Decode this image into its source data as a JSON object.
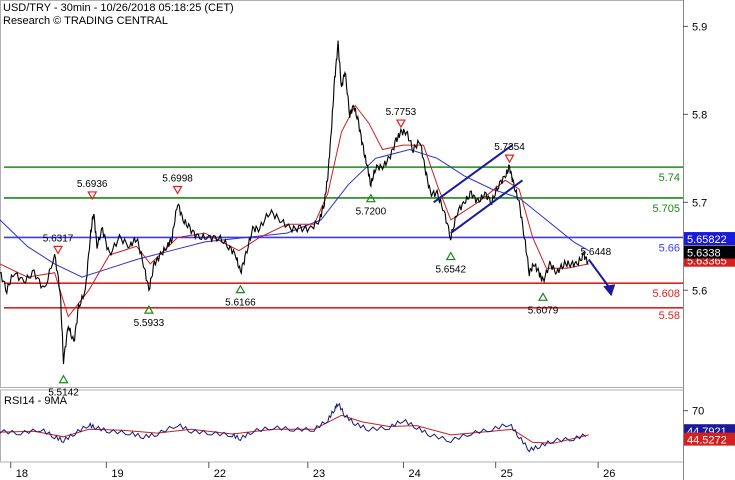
{
  "header": {
    "title": "USD/TRY - 30min - 10/26/2018 05:18:25 (CET)",
    "research": "Research © TRADING CENTRAL"
  },
  "chart_data": [
    {
      "type": "line",
      "name": "price",
      "ylim": [
        5.49,
        5.93
      ],
      "y_ticks": [
        "5.9",
        "5.8",
        "5.7",
        "5.6"
      ],
      "x_tick_labels": [
        "18",
        "19",
        "22",
        "23",
        "24",
        "25",
        "26"
      ],
      "levels": [
        {
          "value": 5.74,
          "label": "5.74",
          "color": "#1a8a1a"
        },
        {
          "value": 5.705,
          "label": "5.705",
          "color": "#1a8a1a"
        },
        {
          "value": 5.66,
          "label": "5.66",
          "color": "#3a3aff"
        },
        {
          "value": 5.608,
          "label": "5.608",
          "color": "#e02020"
        },
        {
          "value": 5.58,
          "label": "5.58",
          "color": "#e02020"
        }
      ],
      "current_price": {
        "label": "5.6338",
        "value": 5.6338
      },
      "price_tags": [
        {
          "label": "5.65822",
          "value": 5.6582,
          "color": "#1a1adb"
        },
        {
          "label": "5.63365",
          "value": 5.6336,
          "color": "#d02020"
        }
      ],
      "highs": [
        {
          "label": "5.6317",
          "x": 0.085,
          "value": 5.6317
        },
        {
          "label": "5.6936",
          "x": 0.135,
          "value": 5.6936
        },
        {
          "label": "5.6998",
          "x": 0.26,
          "value": 5.6998
        },
        {
          "label": "5.7753",
          "x": 0.587,
          "value": 5.7753
        },
        {
          "label": "5.7354",
          "x": 0.746,
          "value": 5.7354
        }
      ],
      "lows": [
        {
          "label": "5.5142",
          "x": 0.093,
          "value": 5.5142
        },
        {
          "label": "5.5933",
          "x": 0.218,
          "value": 5.5933
        },
        {
          "label": "5.6166",
          "x": 0.352,
          "value": 5.6166
        },
        {
          "label": "5.7200",
          "x": 0.543,
          "value": 5.72
        },
        {
          "label": "5.6542",
          "x": 0.66,
          "value": 5.6542
        },
        {
          "label": "5.6079",
          "x": 0.795,
          "value": 5.6079
        }
      ],
      "extra_label": {
        "label": "5.6448",
        "value": 5.6448
      },
      "price_path": [
        [
          0.0,
          5.62
        ],
        [
          0.01,
          5.6
        ],
        [
          0.02,
          5.62
        ],
        [
          0.035,
          5.61
        ],
        [
          0.05,
          5.62
        ],
        [
          0.065,
          5.6
        ],
        [
          0.08,
          5.64
        ],
        [
          0.088,
          5.6
        ],
        [
          0.093,
          5.52
        ],
        [
          0.1,
          5.56
        ],
        [
          0.108,
          5.54
        ],
        [
          0.115,
          5.58
        ],
        [
          0.125,
          5.6
        ],
        [
          0.132,
          5.66
        ],
        [
          0.137,
          5.69
        ],
        [
          0.142,
          5.65
        ],
        [
          0.15,
          5.67
        ],
        [
          0.16,
          5.64
        ],
        [
          0.175,
          5.66
        ],
        [
          0.19,
          5.65
        ],
        [
          0.2,
          5.66
        ],
        [
          0.21,
          5.63
        ],
        [
          0.218,
          5.6
        ],
        [
          0.226,
          5.63
        ],
        [
          0.235,
          5.64
        ],
        [
          0.245,
          5.65
        ],
        [
          0.252,
          5.66
        ],
        [
          0.26,
          5.7
        ],
        [
          0.268,
          5.68
        ],
        [
          0.278,
          5.67
        ],
        [
          0.29,
          5.66
        ],
        [
          0.305,
          5.66
        ],
        [
          0.32,
          5.66
        ],
        [
          0.335,
          5.65
        ],
        [
          0.345,
          5.64
        ],
        [
          0.352,
          5.62
        ],
        [
          0.36,
          5.64
        ],
        [
          0.37,
          5.67
        ],
        [
          0.38,
          5.67
        ],
        [
          0.395,
          5.69
        ],
        [
          0.41,
          5.68
        ],
        [
          0.425,
          5.67
        ],
        [
          0.44,
          5.67
        ],
        [
          0.455,
          5.67
        ],
        [
          0.468,
          5.68
        ],
        [
          0.475,
          5.7
        ],
        [
          0.48,
          5.73
        ],
        [
          0.485,
          5.78
        ],
        [
          0.49,
          5.84
        ],
        [
          0.495,
          5.88
        ],
        [
          0.5,
          5.83
        ],
        [
          0.505,
          5.85
        ],
        [
          0.512,
          5.8
        ],
        [
          0.518,
          5.81
        ],
        [
          0.525,
          5.79
        ],
        [
          0.532,
          5.76
        ],
        [
          0.538,
          5.74
        ],
        [
          0.543,
          5.72
        ],
        [
          0.55,
          5.74
        ],
        [
          0.56,
          5.74
        ],
        [
          0.57,
          5.75
        ],
        [
          0.58,
          5.77
        ],
        [
          0.587,
          5.78
        ],
        [
          0.595,
          5.78
        ],
        [
          0.605,
          5.76
        ],
        [
          0.615,
          5.77
        ],
        [
          0.622,
          5.74
        ],
        [
          0.63,
          5.71
        ],
        [
          0.64,
          5.71
        ],
        [
          0.65,
          5.69
        ],
        [
          0.66,
          5.66
        ],
        [
          0.67,
          5.69
        ],
        [
          0.68,
          5.7
        ],
        [
          0.69,
          5.71
        ],
        [
          0.7,
          5.7
        ],
        [
          0.71,
          5.71
        ],
        [
          0.72,
          5.7
        ],
        [
          0.73,
          5.72
        ],
        [
          0.74,
          5.73
        ],
        [
          0.746,
          5.74
        ],
        [
          0.752,
          5.72
        ],
        [
          0.76,
          5.7
        ],
        [
          0.768,
          5.66
        ],
        [
          0.775,
          5.62
        ],
        [
          0.782,
          5.63
        ],
        [
          0.789,
          5.62
        ],
        [
          0.795,
          5.61
        ],
        [
          0.805,
          5.63
        ],
        [
          0.815,
          5.62
        ],
        [
          0.825,
          5.63
        ],
        [
          0.835,
          5.63
        ],
        [
          0.845,
          5.63
        ],
        [
          0.855,
          5.64
        ],
        [
          0.862,
          5.63
        ]
      ],
      "ma_fast_path": [
        [
          0.0,
          5.63
        ],
        [
          0.04,
          5.615
        ],
        [
          0.08,
          5.62
        ],
        [
          0.1,
          5.57
        ],
        [
          0.13,
          5.6
        ],
        [
          0.16,
          5.64
        ],
        [
          0.2,
          5.65
        ],
        [
          0.22,
          5.63
        ],
        [
          0.26,
          5.66
        ],
        [
          0.3,
          5.665
        ],
        [
          0.35,
          5.645
        ],
        [
          0.38,
          5.66
        ],
        [
          0.42,
          5.675
        ],
        [
          0.46,
          5.675
        ],
        [
          0.48,
          5.71
        ],
        [
          0.5,
          5.78
        ],
        [
          0.52,
          5.81
        ],
        [
          0.54,
          5.79
        ],
        [
          0.56,
          5.76
        ],
        [
          0.59,
          5.765
        ],
        [
          0.62,
          5.765
        ],
        [
          0.64,
          5.72
        ],
        [
          0.66,
          5.68
        ],
        [
          0.7,
          5.7
        ],
        [
          0.74,
          5.725
        ],
        [
          0.76,
          5.715
        ],
        [
          0.78,
          5.66
        ],
        [
          0.8,
          5.625
        ],
        [
          0.83,
          5.625
        ],
        [
          0.862,
          5.63
        ]
      ],
      "ma_slow_path": [
        [
          0.0,
          5.68
        ],
        [
          0.04,
          5.65
        ],
        [
          0.08,
          5.63
        ],
        [
          0.12,
          5.615
        ],
        [
          0.16,
          5.625
        ],
        [
          0.2,
          5.635
        ],
        [
          0.25,
          5.645
        ],
        [
          0.3,
          5.655
        ],
        [
          0.36,
          5.66
        ],
        [
          0.42,
          5.665
        ],
        [
          0.47,
          5.68
        ],
        [
          0.51,
          5.72
        ],
        [
          0.55,
          5.75
        ],
        [
          0.6,
          5.76
        ],
        [
          0.64,
          5.75
        ],
        [
          0.68,
          5.73
        ],
        [
          0.72,
          5.715
        ],
        [
          0.76,
          5.705
        ],
        [
          0.8,
          5.68
        ],
        [
          0.84,
          5.655
        ],
        [
          0.862,
          5.645
        ]
      ],
      "channel": [
        [
          [
            0.635,
            5.7
          ],
          [
            0.75,
            5.765
          ]
        ],
        [
          [
            0.66,
            5.665
          ],
          [
            0.765,
            5.725
          ]
        ]
      ],
      "arrow": [
        [
          0.862,
          5.635
        ],
        [
          0.895,
          5.6
        ]
      ]
    },
    {
      "type": "line",
      "name": "RSI14 - 9MA",
      "ylim": [
        15,
        90
      ],
      "y_ticks": [
        "70"
      ],
      "rsi_value_label": "44.7921",
      "ma_value_label": "44.5272",
      "rsi_path": [
        [
          0.0,
          48
        ],
        [
          0.03,
          46
        ],
        [
          0.06,
          50
        ],
        [
          0.08,
          42
        ],
        [
          0.093,
          38
        ],
        [
          0.11,
          46
        ],
        [
          0.13,
          55
        ],
        [
          0.14,
          52
        ],
        [
          0.16,
          48
        ],
        [
          0.19,
          46
        ],
        [
          0.21,
          42
        ],
        [
          0.23,
          45
        ],
        [
          0.26,
          55
        ],
        [
          0.28,
          48
        ],
        [
          0.31,
          46
        ],
        [
          0.34,
          44
        ],
        [
          0.352,
          40
        ],
        [
          0.37,
          48
        ],
        [
          0.4,
          52
        ],
        [
          0.43,
          50
        ],
        [
          0.46,
          50
        ],
        [
          0.48,
          60
        ],
        [
          0.49,
          72
        ],
        [
          0.495,
          78
        ],
        [
          0.505,
          65
        ],
        [
          0.52,
          56
        ],
        [
          0.54,
          50
        ],
        [
          0.57,
          52
        ],
        [
          0.59,
          60
        ],
        [
          0.61,
          52
        ],
        [
          0.63,
          44
        ],
        [
          0.66,
          38
        ],
        [
          0.69,
          46
        ],
        [
          0.72,
          50
        ],
        [
          0.746,
          56
        ],
        [
          0.76,
          42
        ],
        [
          0.775,
          28
        ],
        [
          0.79,
          32
        ],
        [
          0.81,
          38
        ],
        [
          0.84,
          40
        ],
        [
          0.862,
          45
        ]
      ],
      "rsi_ma_path": [
        [
          0.0,
          47
        ],
        [
          0.05,
          48
        ],
        [
          0.093,
          42
        ],
        [
          0.13,
          50
        ],
        [
          0.18,
          49
        ],
        [
          0.23,
          46
        ],
        [
          0.28,
          50
        ],
        [
          0.34,
          45
        ],
        [
          0.4,
          50
        ],
        [
          0.46,
          50
        ],
        [
          0.5,
          65
        ],
        [
          0.53,
          58
        ],
        [
          0.57,
          53
        ],
        [
          0.61,
          54
        ],
        [
          0.66,
          44
        ],
        [
          0.72,
          48
        ],
        [
          0.75,
          50
        ],
        [
          0.78,
          36
        ],
        [
          0.81,
          35
        ],
        [
          0.862,
          44
        ]
      ]
    }
  ],
  "colors": {
    "green_level": "#1a8a1a",
    "blue_level": "#3a3aff",
    "red_level": "#e02020",
    "price": "#000000",
    "ma_fast": "#cc2020",
    "ma_slow": "#3030cc",
    "channel": "#1a1a9a",
    "high_marker": "#e02020",
    "low_marker": "#1a8a1a"
  }
}
